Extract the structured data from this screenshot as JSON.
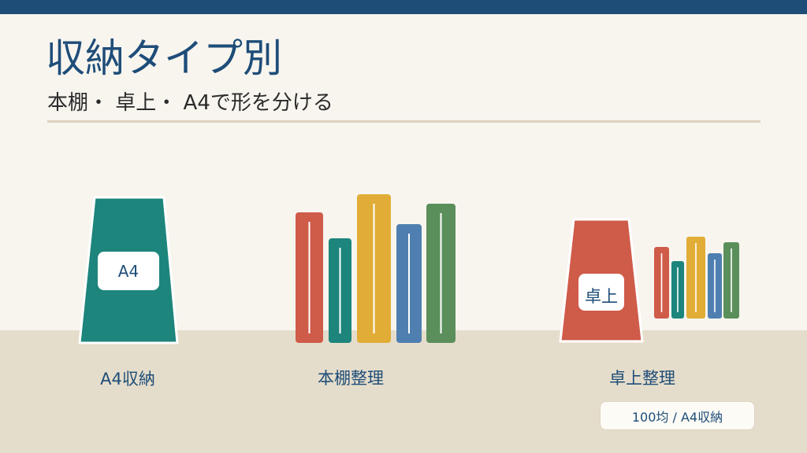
{
  "title": "収納タイプ別",
  "subtitle": "本棚・ 卓上・ A4で形を分ける",
  "items": [
    {
      "label": "A4収納",
      "tag": "A4"
    },
    {
      "label": "本棚整理"
    },
    {
      "label": "卓上整理",
      "tag": "卓上"
    }
  ],
  "badge": "100均 / A4収納",
  "icons": [
    "a4-file-box-icon",
    "bookshelf-books-icon",
    "desk-organizer-icon"
  ],
  "colors": {
    "accent": "#1e4d78",
    "background": "#f8f5ef",
    "floor": "#e5ddcb",
    "teal": "#1d857c",
    "red": "#cf5b49",
    "yellow": "#e1ad36",
    "blue": "#4f7fb1",
    "green": "#5a8f5c"
  }
}
